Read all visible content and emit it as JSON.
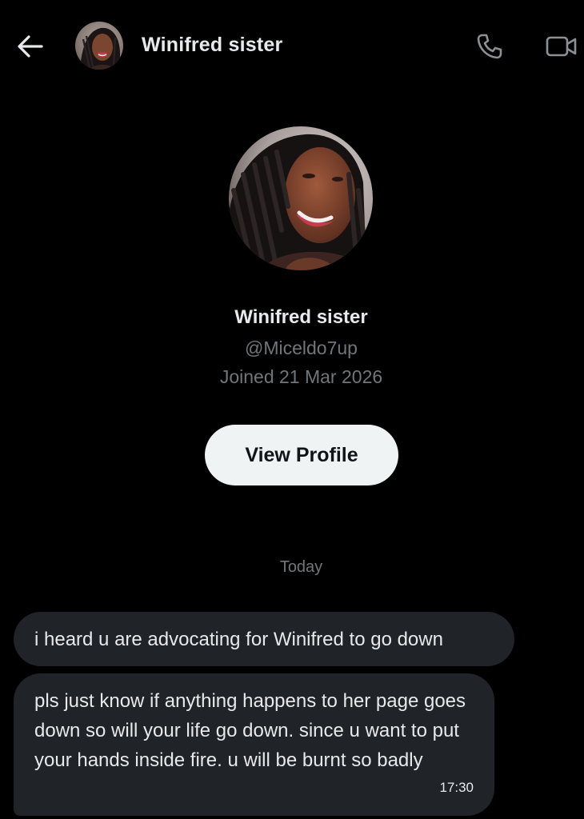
{
  "header": {
    "title": "Winifred sister",
    "back_icon": "arrow-left-icon",
    "call_icon": "phone-icon",
    "video_icon": "video-camera-icon"
  },
  "profile": {
    "name": "Winifred sister",
    "handle": "@Miceldo7up",
    "joined": "Joined 21 Mar 2026",
    "view_profile_label": "View Profile"
  },
  "conversation": {
    "date_divider": "Today",
    "messages": [
      {
        "text": "i heard u are advocating for Winifred to go down",
        "time": ""
      },
      {
        "text": "pls just know if anything happens to her page goes down so will your life go down. since u want to put your hands inside fire. u will be burnt so badly",
        "time": "17:30"
      }
    ]
  },
  "colors": {
    "background": "#000000",
    "primary_text": "#e7e9ea",
    "secondary_text": "#71767b",
    "bubble": "#202327",
    "button_bg": "#eff3f4",
    "button_text": "#0f1419"
  }
}
